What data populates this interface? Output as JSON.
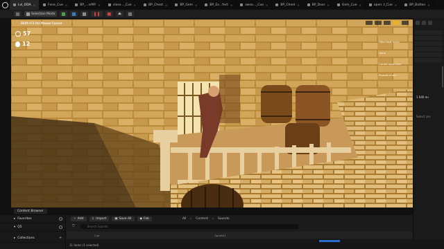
{
  "tabs": [
    {
      "label": "Lvl_ODA",
      "active": true
    },
    {
      "label": "Fone_Cue",
      "active": false
    },
    {
      "label": "BP_...srMY",
      "active": false
    },
    {
      "label": "close..._Cue",
      "active": false
    },
    {
      "label": "BP_Chest",
      "active": false
    },
    {
      "label": "BP_Gem",
      "active": false
    },
    {
      "label": "BP_Ex...fect",
      "active": false
    },
    {
      "label": "swoo..._Cue",
      "active": false
    },
    {
      "label": "BP_Chest",
      "active": false
    },
    {
      "label": "BP_Door",
      "active": false
    },
    {
      "label": "Gem_Cue",
      "active": false
    },
    {
      "label": "open..t_Cue",
      "active": false
    },
    {
      "label": "BP_Button",
      "active": false
    }
  ],
  "toolbar": {
    "mode_label": "Selection Mode"
  },
  "viewport": {
    "hint": "Shift+F1 for Mouse Cursor",
    "hud_timer": "57",
    "hud_health": "12",
    "menu_items": [
      "Обычный ключ",
      "Цепь",
      "Синий кристалл",
      "Рыжий ключ"
    ],
    "accent": "#e8b030"
  },
  "right_panel": {
    "value": "1 640 лн",
    "select_label": "Select Lev"
  },
  "content_browser": {
    "tab_label": "Content Browser",
    "sections": [
      "Favorites",
      "Q5",
      "Collections"
    ],
    "add_label": "Add",
    "import_label": "Import",
    "save_all_label": "Save All",
    "fab_label": "Fab",
    "path": [
      "All",
      "Content",
      "Sounds"
    ],
    "search_placeholder": "Search Sounds",
    "grid_labels": [
      "Cue",
      "Sprint01"
    ],
    "items_count": "31 items (1 selected)"
  }
}
